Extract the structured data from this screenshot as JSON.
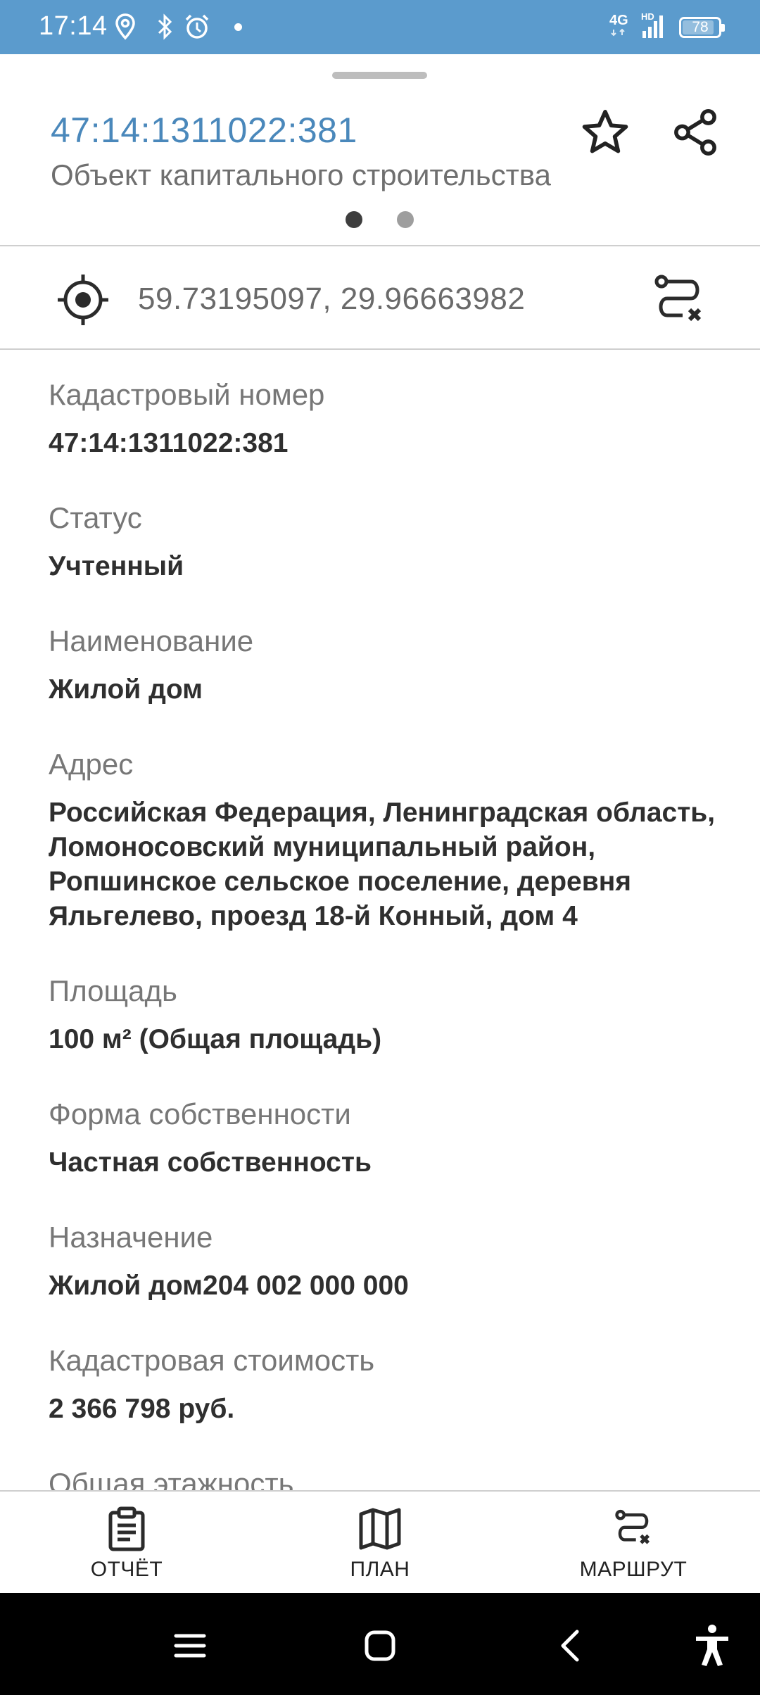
{
  "status_bar": {
    "time": "17:14",
    "network": "4G",
    "hd": "HD",
    "battery": "78",
    "icons": [
      "location-icon",
      "bluetooth-icon",
      "alarm-icon",
      "notification-dot",
      "signal-icon",
      "battery-icon"
    ]
  },
  "header": {
    "object_id": "47:14:1311022:381",
    "object_type": "Объект капитального строительства",
    "pager": {
      "count": 2,
      "active": 0
    }
  },
  "coordinates": {
    "text": "59.73195097, 29.96663982"
  },
  "fields": [
    {
      "label": "Кадастровый номер",
      "value": "47:14:1311022:381"
    },
    {
      "label": "Статус",
      "value": "Учтенный"
    },
    {
      "label": "Наименование",
      "value": "Жилой дом"
    },
    {
      "label": "Адрес",
      "value": "Российская Федерация, Ленинградская область, Ломоносовский муниципальный район, Ропшинское сельское поселение, деревня Яльгелево, проезд 18-й Конный, дом 4"
    },
    {
      "label": "Площадь",
      "value": "100 м² (Общая площадь)"
    },
    {
      "label": "Форма собственности",
      "value": "Частная собственность"
    },
    {
      "label": "Назначение",
      "value": "Жилой дом204 002 000 000"
    },
    {
      "label": "Кадастровая стоимость",
      "value": "2 366 798 руб."
    },
    {
      "label": "Общая этажность",
      "value": ""
    }
  ],
  "bottom_nav": {
    "report": "ОТЧЁТ",
    "plan": "ПЛАН",
    "route": "МАРШРУТ"
  },
  "colors": {
    "status_bar": "#5b9bcd",
    "accent_text": "#4a88bb",
    "label_text": "#777777",
    "value_text": "#2f2f2f"
  }
}
